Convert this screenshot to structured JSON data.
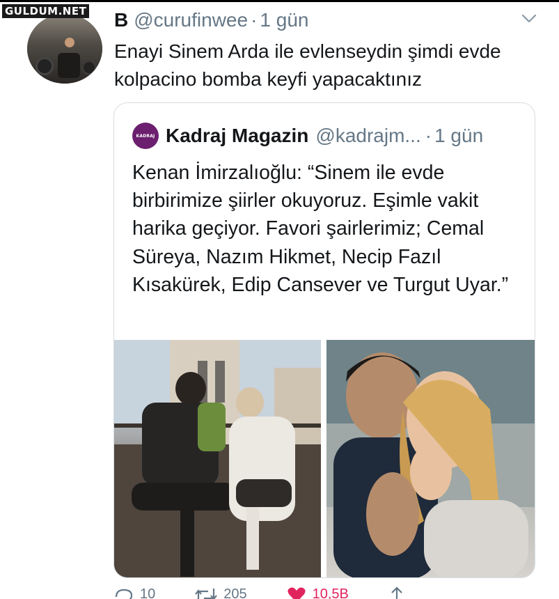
{
  "watermark": "GULDUM.NET",
  "tweet": {
    "display_name": "B",
    "handle": "@curufinwee",
    "separator": "·",
    "time": "1 gün",
    "text": "Enayi Sinem Arda ile evlenseydin şimdi evde kolpacino bomba keyfi yapacaktınız"
  },
  "quoted": {
    "logo_text": "KADRAJ",
    "display_name": "Kadraj Magazin",
    "handle": "@kadrajm...",
    "separator": "·",
    "time": "1 gün",
    "text": "Kenan İmirzalıoğlu: “Sinem ile evde birbirimize şiirler okuyoruz. Eşimle vakit harika geçiyor. Favori şairlerimiz; Cemal Süreya, Nazım Hikmet, Necip Fazıl Kısakürek, Edip Cansever ve Turgut Uyar.”"
  },
  "actions": {
    "reply_count": "10",
    "retweet_count": "205",
    "like_count": "10,5B",
    "like_color": "#e0245e",
    "icons": [
      "reply-icon",
      "retweet-icon",
      "heart-icon",
      "share-icon"
    ]
  },
  "colors": {
    "text": "#14171a",
    "muted": "#657786",
    "border": "#d7dde2",
    "brand_logo": "#6b1f6e"
  }
}
